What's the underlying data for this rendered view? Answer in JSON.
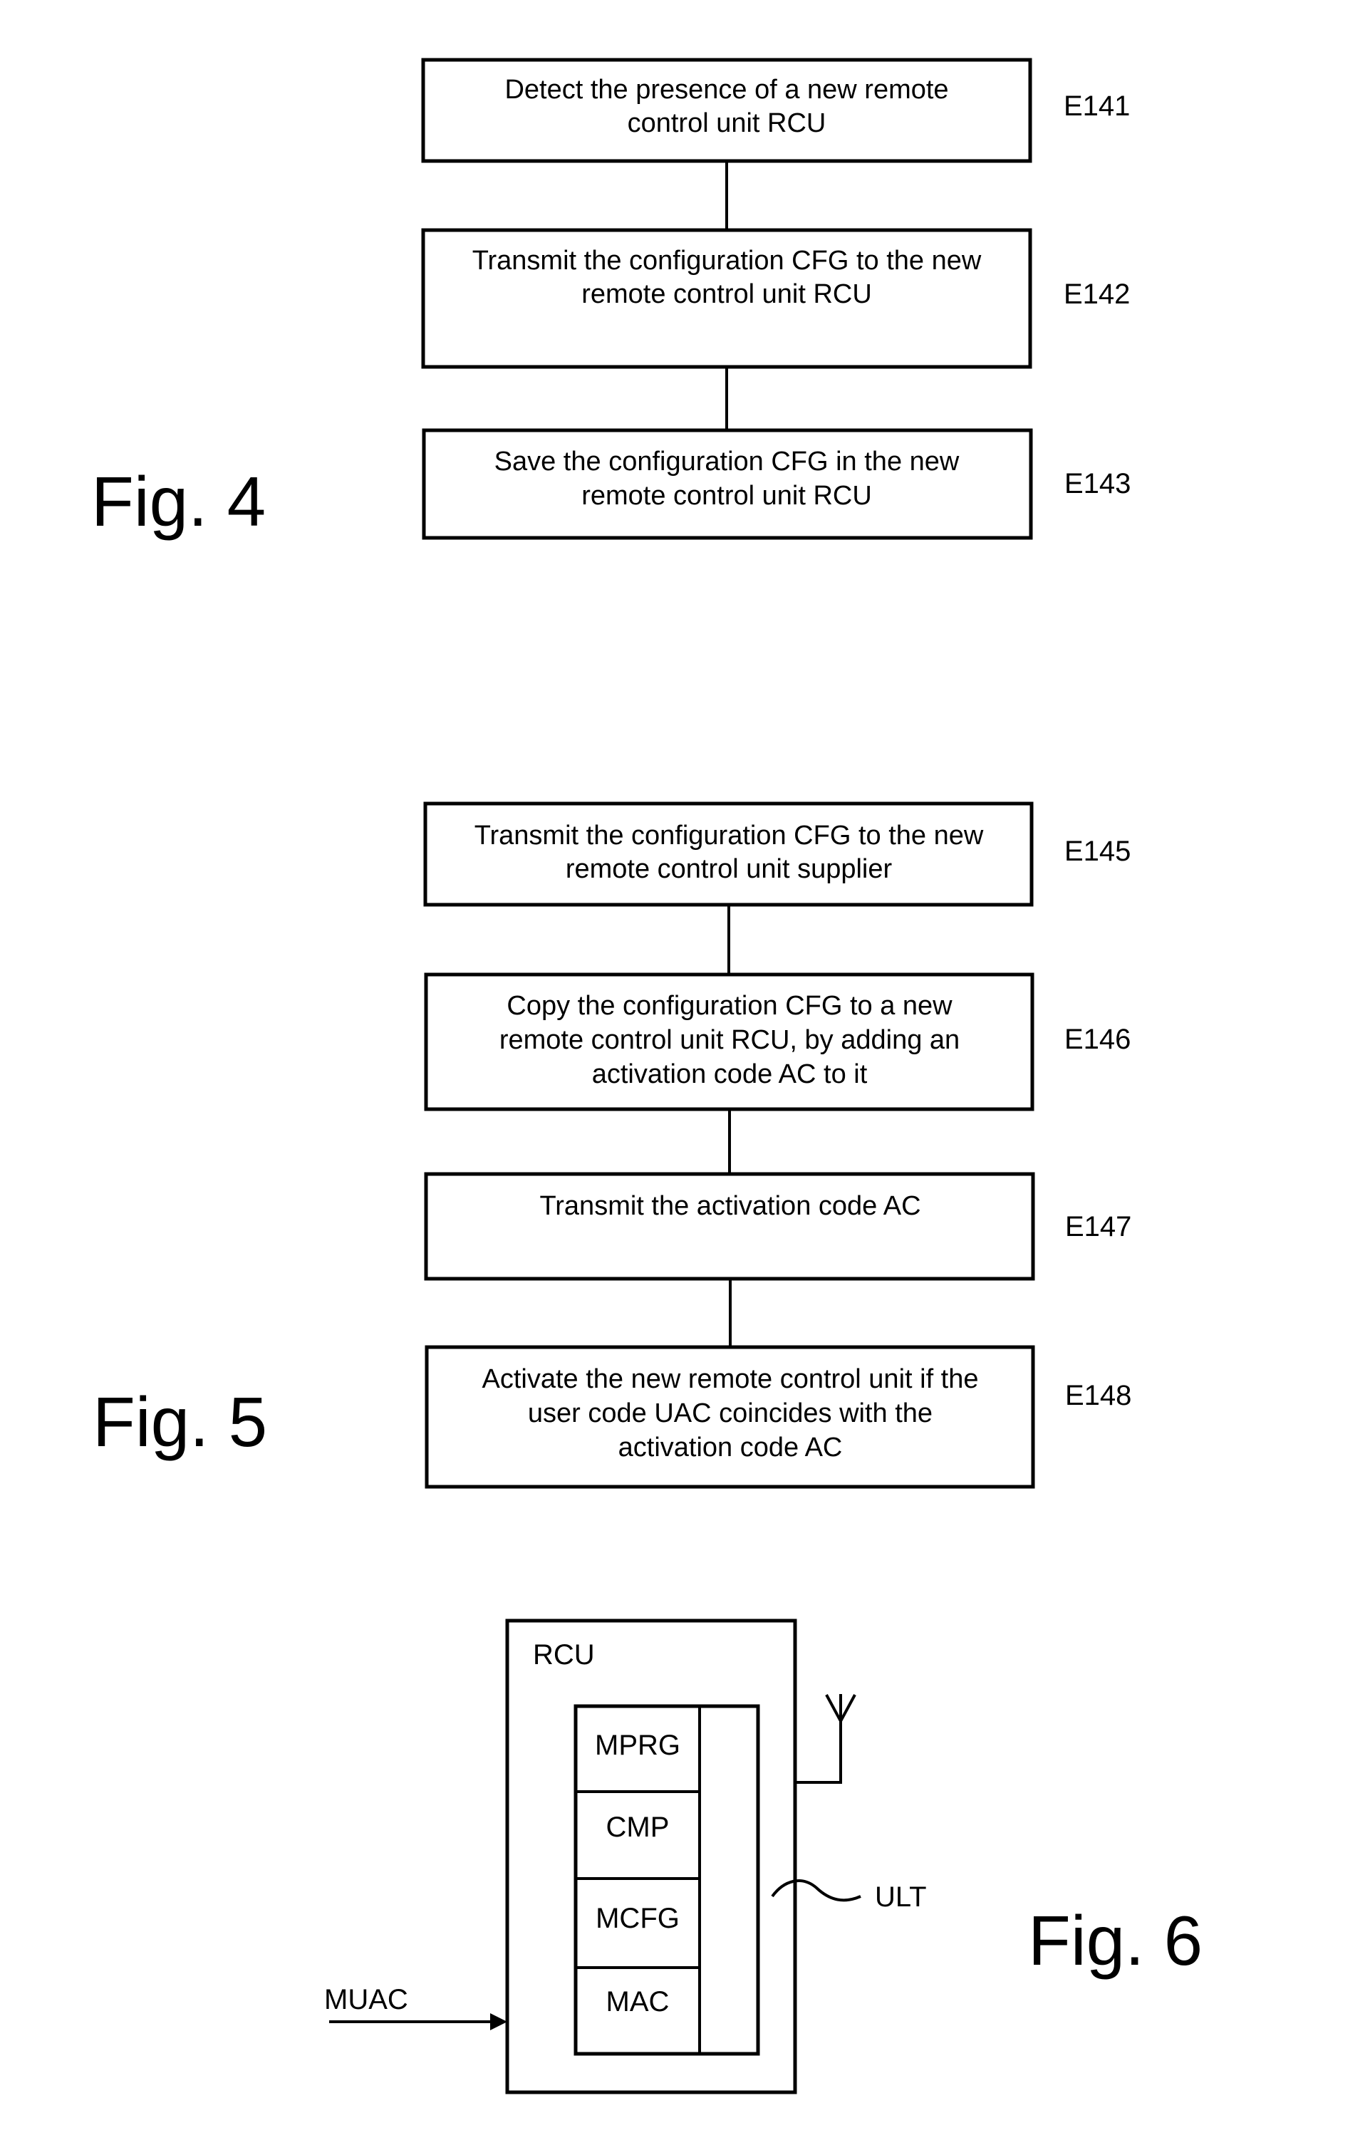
{
  "figures": {
    "fig4": {
      "label": "Fig. 4",
      "steps": [
        {
          "id": "E141",
          "lines": [
            "Detect the presence of a new remote",
            "control unit RCU"
          ]
        },
        {
          "id": "E142",
          "lines": [
            "Transmit the configuration CFG to the new",
            "remote control unit RCU"
          ]
        },
        {
          "id": "E143",
          "lines": [
            "Save the configuration CFG in the new",
            "remote control unit RCU"
          ]
        }
      ]
    },
    "fig5": {
      "label": "Fig. 5",
      "steps": [
        {
          "id": "E145",
          "lines": [
            "Transmit the configuration CFG to the new",
            "remote control unit supplier"
          ]
        },
        {
          "id": "E146",
          "lines": [
            "Copy the configuration CFG to a new",
            "remote control unit RCU, by adding an",
            "activation code AC to it"
          ]
        },
        {
          "id": "E147",
          "lines": [
            "Transmit the activation code AC"
          ]
        },
        {
          "id": "E148",
          "lines": [
            "Activate the new remote control unit if the",
            "user code UAC coincides with the",
            "activation code AC"
          ]
        }
      ]
    },
    "fig6": {
      "label": "Fig. 6",
      "device_label": "RCU",
      "modules": [
        "MPRG",
        "CMP",
        "MCFG",
        "MAC"
      ],
      "bus_label": "ULT",
      "input_label": "MUAC",
      "antenna_icon": "antenna-icon"
    }
  }
}
